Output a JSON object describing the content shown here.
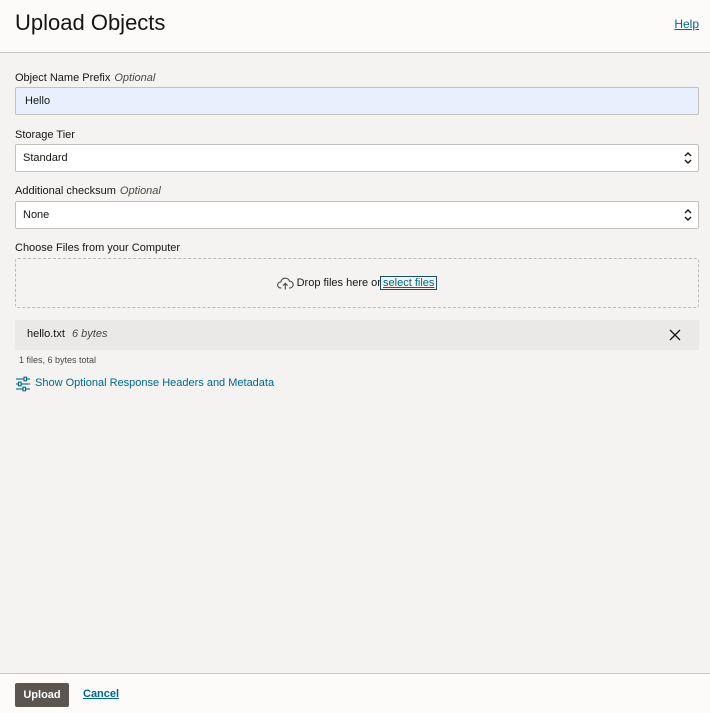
{
  "header": {
    "title": "Upload Objects",
    "help_label": "Help"
  },
  "form": {
    "prefix": {
      "label": "Object Name Prefix",
      "optional": "Optional",
      "value": "Hello"
    },
    "storage_tier": {
      "label": "Storage Tier",
      "selected": "Standard"
    },
    "checksum": {
      "label": "Additional checksum",
      "optional": "Optional",
      "selected": "None"
    },
    "choose_files": {
      "label": "Choose Files from your Computer",
      "drop_text": "Drop files here or",
      "select_link": "select files"
    },
    "files": [
      {
        "name": "hello.txt",
        "size": "6 bytes"
      }
    ],
    "summary": "1 files, 6 bytes total",
    "optional_headers_link": "Show Optional Response Headers and Metadata"
  },
  "footer": {
    "upload_label": "Upload",
    "cancel_label": "Cancel"
  },
  "colors": {
    "link": "#00688c",
    "primary_button": "#5b5652",
    "autofill_input": "#e8f0fe"
  },
  "icons": [
    "cloud-upload-icon",
    "chevron-updown-icon",
    "close-icon",
    "sliders-icon"
  ]
}
